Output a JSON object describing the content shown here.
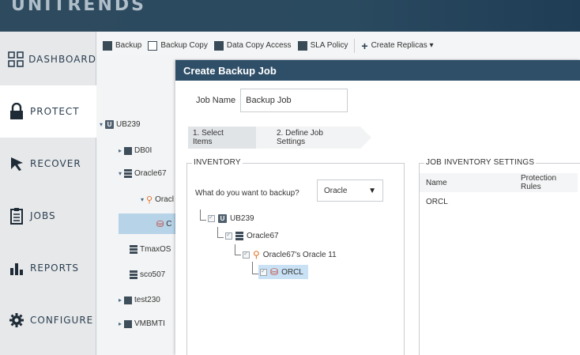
{
  "app": {
    "brand": "UNITRENDS"
  },
  "colors": {
    "topbar": "#2e4a5e",
    "modal_header": "#2f4f69",
    "selection": "#c8e1f4",
    "accent_orange": "#e0752a",
    "accent_red": "#c0392b"
  },
  "nav": {
    "items": [
      {
        "label": "DASHBOARD",
        "icon": "grid-icon"
      },
      {
        "label": "PROTECT",
        "icon": "lock-icon",
        "active": true
      },
      {
        "label": "RECOVER",
        "icon": "arrow-icon"
      },
      {
        "label": "JOBS",
        "icon": "clipboard-icon"
      },
      {
        "label": "REPORTS",
        "icon": "bar-chart-icon"
      },
      {
        "label": "CONFIGURE",
        "icon": "gear-icon"
      }
    ]
  },
  "toolbar": {
    "backup": "Backup",
    "backup_copy": "Backup Copy",
    "data_copy_access": "Data Copy Access",
    "sla_policy": "SLA Policy",
    "create_replicas": "Create Replicas ▾"
  },
  "side_tree": {
    "ub239": "UB239",
    "db01": "DB0I",
    "oracle67": "Oracle67",
    "oracle_partial": "Oracl",
    "selected_partial": "C",
    "tmaxos": "TmaxOS",
    "sco507": "sco507",
    "test230": "test230",
    "vmbmti": "VMBMTI"
  },
  "modal": {
    "title": "Create Backup Job",
    "job_name_label": "Job Name",
    "job_name_value": "Backup Job",
    "steps": [
      "1. Select Items",
      "2. Define Job Settings"
    ],
    "inventory": {
      "legend": "INVENTORY",
      "question": "What do you want to backup?",
      "selected_type": "Oracle",
      "tree": {
        "server": "UB239",
        "host": "Oracle67",
        "instance": "Oracle67's Oracle 11",
        "database": "ORCL"
      }
    },
    "settings": {
      "legend": "JOB INVENTORY SETTINGS",
      "columns": [
        "Name",
        "Protection Rules"
      ],
      "rows": [
        [
          "ORCL",
          ""
        ]
      ]
    }
  }
}
